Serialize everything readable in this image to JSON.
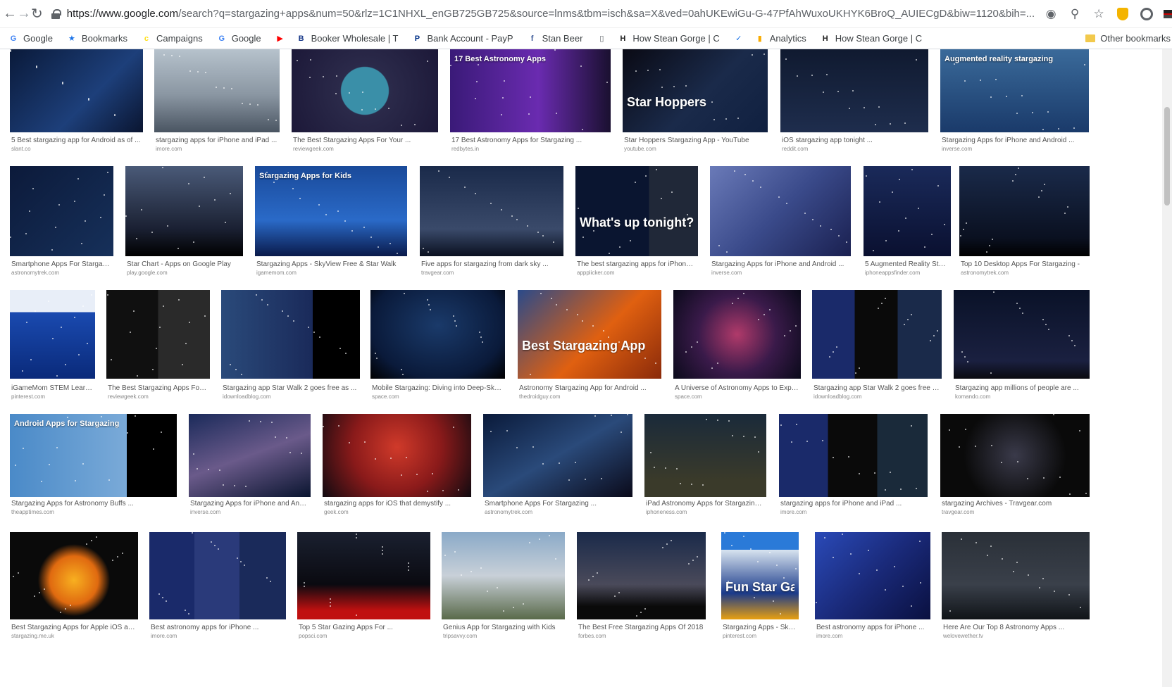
{
  "browser": {
    "url_host": "https://www.google.com",
    "url_rest": "/search?q=stargazing+apps&num=50&rlz=1C1NHXL_enGB725GB725&source=lnms&tbm=isch&sa=X&ved=0ahUKEwiGu-G-47PfAhWuxoUKHYK6BroQ_AUIECgD&biw=1120&bih=..."
  },
  "bookmarks": [
    {
      "label": "Google",
      "icon": "google-icon",
      "color": "#4285f4",
      "glyph": "G"
    },
    {
      "label": "Bookmarks",
      "icon": "star-icon",
      "color": "#1a73e8",
      "glyph": "★"
    },
    {
      "label": "Campaigns",
      "icon": "mailchimp-icon",
      "color": "#ffe01b",
      "glyph": "c"
    },
    {
      "label": "Google",
      "icon": "google-icon",
      "color": "#4285f4",
      "glyph": "G"
    },
    {
      "label": "",
      "icon": "youtube-icon",
      "color": "#ff0000",
      "glyph": "▶"
    },
    {
      "label": "Booker Wholesale | T",
      "icon": "booker-icon",
      "color": "#1a3a8a",
      "glyph": "B"
    },
    {
      "label": "Bank Account - PayP",
      "icon": "paypal-icon",
      "color": "#003087",
      "glyph": "P"
    },
    {
      "label": "Stan Beer",
      "icon": "facebook-icon",
      "color": "#3b5998",
      "glyph": "f"
    },
    {
      "label": "",
      "icon": "page-icon",
      "color": "#5f6368",
      "glyph": "▯"
    },
    {
      "label": "How Stean Gorge | C",
      "icon": "howstean-icon",
      "color": "#222222",
      "glyph": "H"
    },
    {
      "label": "",
      "icon": "checkbox-icon",
      "color": "#1a73e8",
      "glyph": "✓"
    },
    {
      "label": "Analytics",
      "icon": "analytics-icon",
      "color": "#f9ab00",
      "glyph": "▮"
    },
    {
      "label": "How Stean Gorge | C",
      "icon": "howstean-icon",
      "color": "#222222",
      "glyph": "H"
    }
  ],
  "other_bookmarks": "Other bookmarks",
  "results": [
    {
      "caption": "5 Best stargazing app for Android as of ...",
      "source": "slant.co",
      "bg": "linear-gradient(135deg,#0a1a3a,#1d3f7a 60%,#0a1530)",
      "text": ""
    },
    {
      "caption": "stargazing apps for iPhone and iPad ...",
      "source": "imore.com",
      "bg": "linear-gradient(180deg,#b6c2cc,#8a96a2 55%,#4a5562)",
      "text": ""
    },
    {
      "caption": "The Best Stargazing Apps For Your ...",
      "source": "reviewgeek.com",
      "bg": "radial-gradient(circle at 50% 50%,#3a8fa8 0 28%,#2b2a4a 29%,#1c1838 100%)",
      "text": ""
    },
    {
      "caption": "17 Best Astronomy Apps for Stargazing ...",
      "source": "redbytes.in",
      "bg": "linear-gradient(90deg,#3a1a78,#6a2bb0 55%,#1a1030)",
      "text": "17  Best Astronomy Apps"
    },
    {
      "caption": "Star Hoppers Stargazing App - YouTube",
      "source": "youtube.com",
      "bg": "linear-gradient(135deg,#0a0a14,#1a2a4a 55%,#102040)",
      "text": "Star Hoppers"
    },
    {
      "caption": "iOS stargazing app tonight ...",
      "source": "reddit.com",
      "bg": "linear-gradient(180deg,#101a30,#1e2d4d)",
      "text": ""
    },
    {
      "caption": "Stargazing Apps for iPhone and Android ...",
      "source": "inverse.com",
      "bg": "linear-gradient(180deg,#3a6a9a,#1a3a6a)",
      "text": "Augmented reality stargazing"
    },
    {
      "caption": "Smartphone Apps For Stargazing ...",
      "source": "astronomytrek.com",
      "bg": "linear-gradient(135deg,#0c1a3a,#16305a)",
      "text": ""
    },
    {
      "caption": "Star Chart - Apps on Google Play",
      "source": "play.google.com",
      "bg": "linear-gradient(180deg,#4a5a78,#1a2032 70%,#000)",
      "text": ""
    },
    {
      "caption": "Stargazing Apps - SkyView Free & Star Walk",
      "source": "igamemom.com",
      "bg": "linear-gradient(180deg,#1a4a9a,#2a6ac8 60%,#0a1a4a)",
      "text": "Stargazing Apps for Kids"
    },
    {
      "caption": "Five apps for stargazing from dark sky ...",
      "source": "travgear.com",
      "bg": "linear-gradient(180deg,#1a2a4a,#3a4a6a 70%,#0a1020)",
      "text": ""
    },
    {
      "caption": "The best stargazing apps for iPhone ...",
      "source": "appplicker.com",
      "bg": "linear-gradient(90deg,#0a1530 60%,#202838 60%)",
      "text": "What's up tonight?"
    },
    {
      "caption": "Stargazing Apps for iPhone and Android ...",
      "source": "inverse.com",
      "bg": "linear-gradient(135deg,#6a7ab8,#3a4a8a 50%,#1a2050)",
      "text": ""
    },
    {
      "caption": "5 Augmented Reality Starg...",
      "source": "iphoneappsfinder.com",
      "bg": "linear-gradient(180deg,#1a2a5a,#0a1030)",
      "text": ""
    },
    {
      "caption": "Top 10 Desktop Apps For Stargazing -",
      "source": "astronomytrek.com",
      "bg": "linear-gradient(180deg,#1a2a4a,#0a1020 80%,#000)",
      "text": ""
    },
    {
      "caption": "iGameMom STEM Learnin...",
      "source": "pinterest.com",
      "bg": "linear-gradient(180deg,#e8eef8 0 25%,#1a4ab0 25%,#0a2a7a)",
      "text": ""
    },
    {
      "caption": "The Best Stargazing Apps For Yo...",
      "source": "reviewgeek.com",
      "bg": "linear-gradient(90deg,#101010 50%,#2a2a2a 50%)",
      "text": ""
    },
    {
      "caption": "Stargazing app Star Walk 2 goes free as ...",
      "source": "idownloadblog.com",
      "bg": "linear-gradient(90deg,#2a4a7a,#1a2a5a 66%,#000 66%)",
      "text": ""
    },
    {
      "caption": "Mobile Stargazing: Diving into Deep-Sky ...",
      "source": "space.com",
      "bg": "radial-gradient(ellipse at 50% 40%,#1a3a6a,#0a1a3a 70%,#000)",
      "text": ""
    },
    {
      "caption": "Astronomy Stargazing App for Android ...",
      "source": "thedroidguy.com",
      "bg": "linear-gradient(135deg,#2a4a8a,#e06010 55%,#8a2a0a)",
      "text": "Best Stargazing App"
    },
    {
      "caption": "A Universe of Astronomy Apps to Explore ...",
      "source": "space.com",
      "bg": "radial-gradient(circle at 50% 50%,#b03a6a,#3a1a4a 50%,#0a0a1a)",
      "text": ""
    },
    {
      "caption": "Stargazing app Star Walk 2 goes free as ...",
      "source": "idownloadblog.com",
      "bg": "linear-gradient(90deg,#1a2a6a 33%,#0a0a0a 33%,#0a0a0a 66%,#1a2a4a 66%)",
      "text": ""
    },
    {
      "caption": "Stargazing app millions of people are ...",
      "source": "komando.com",
      "bg": "linear-gradient(180deg,#0a1228,#1a2040 80%,#0a0a10)",
      "text": ""
    },
    {
      "caption": "Stargazing Apps for Astronomy Buffs ...",
      "source": "theapptimes.com",
      "bg": "linear-gradient(90deg,#4a8ac8,#7aaad8 70%,#000 70%)",
      "text": "Android Apps for Stargazing"
    },
    {
      "caption": "Stargazing Apps for iPhone and Android ...",
      "source": "inverse.com",
      "bg": "linear-gradient(160deg,#1a2a5a,#6a5a8a 50%,#0a1530)",
      "text": ""
    },
    {
      "caption": "stargazing apps for iOS that demystify ...",
      "source": "geek.com",
      "bg": "radial-gradient(circle at 50% 40%,#d03a2a,#8a1a1a 50%,#100a10)",
      "text": ""
    },
    {
      "caption": "Smartphone Apps For Stargazing ...",
      "source": "astronomytrek.com",
      "bg": "linear-gradient(150deg,#0a1a3a,#2a4a7a 50%,#0a0a1a)",
      "text": ""
    },
    {
      "caption": "iPad Astronomy Apps for Stargazing ...",
      "source": "iphoneness.com",
      "bg": "linear-gradient(180deg,#1a2a3a,#3a3a2a 80%)",
      "text": ""
    },
    {
      "caption": "stargazing apps for iPhone and iPad ...",
      "source": "imore.com",
      "bg": "linear-gradient(90deg,#1a2a6a 33%,#0a0a0a 33%,#0a0a0a 66%,#1a2a3a 66%)",
      "text": ""
    },
    {
      "caption": "stargazing Archives - Travgear.com",
      "source": "travgear.com",
      "bg": "radial-gradient(circle at 50% 50%,#3a3a4a,#0a0a0a 60%)",
      "text": ""
    },
    {
      "caption": "Best Stargazing Apps for Apple iOS and ...",
      "source": "stargazing.me.uk",
      "bg": "radial-gradient(circle at 50% 55%,#f8b020,#e06a10 30%,#0a0a0a 45%)",
      "text": ""
    },
    {
      "caption": "Best astronomy apps for iPhone ...",
      "source": "imore.com",
      "bg": "linear-gradient(90deg,#1a2a6a 33%,#2a3a7a 33%,#2a3a7a 66%,#1a2a5a 66%)",
      "text": ""
    },
    {
      "caption": "Top 5 Star Gazing Apps For ...",
      "source": "popsci.com",
      "bg": "linear-gradient(180deg,#1a2030,#0a0a10 60%,#c01010 90%)",
      "text": ""
    },
    {
      "caption": "Genius App for Stargazing with Kids",
      "source": "tripsavvy.com",
      "bg": "linear-gradient(180deg,#8aaac8,#c8d0d8 50%,#5a6a4a)",
      "text": ""
    },
    {
      "caption": "The Best Free Stargazing Apps Of 2018",
      "source": "forbes.com",
      "bg": "linear-gradient(180deg,#1a2a4a,#4a4a5a 60%,#0a0a0a 85%)",
      "text": ""
    },
    {
      "caption": "Stargazing Apps - SkyView...",
      "source": "pinterest.com",
      "bg": "linear-gradient(180deg,#2a7ad8 0 20%,#d8e4f0 20%,#1a3a8a 70%,#e8a010)",
      "text": "Fun Star Gazing Apps"
    },
    {
      "caption": "Best astronomy apps for iPhone ...",
      "source": "imore.com",
      "bg": "linear-gradient(135deg,#2a4ab8,#1a2a7a 50%,#0a1040)",
      "text": ""
    },
    {
      "caption": "Here Are Our Top 8 Astronomy Apps ...",
      "source": "welovewether.tv",
      "bg": "linear-gradient(180deg,#2a3038,#3a404a 60%,#101418)",
      "text": ""
    }
  ]
}
